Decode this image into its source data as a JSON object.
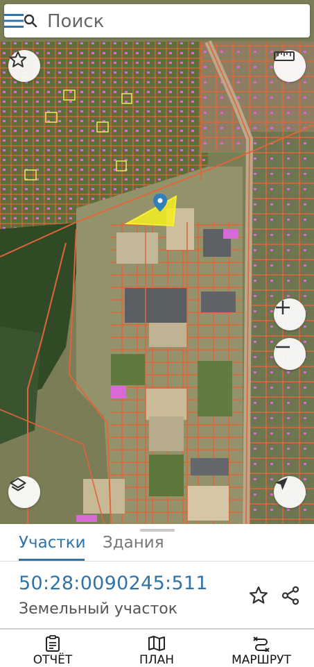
{
  "search": {
    "placeholder": "Поиск"
  },
  "icons": {
    "search": "search-icon",
    "menu": "menu-icon",
    "favorite": "star-outline-icon",
    "ruler": "ruler-icon",
    "zoom_in": "plus-icon",
    "zoom_out": "minus-icon",
    "layers": "layers-icon",
    "location": "navigation-arrow-icon",
    "parcel_marker": "map-pin-icon",
    "report": "clipboard-icon",
    "plan": "map-icon",
    "route": "route-icon",
    "share": "share-icon"
  },
  "colors": {
    "accent": "#2f74a8",
    "parcel_border": "#e0663a",
    "selected_parcel": "#f4ee1f",
    "building": "#d86ad8"
  },
  "sheet": {
    "tabs": [
      "Участки",
      "Здания"
    ],
    "active_tab": "Участки",
    "cadastral_number": "50:28:0090245:511",
    "land_type": "Земельный участок"
  },
  "bottom_nav": {
    "report": "ОТЧЁТ",
    "plan": "ПЛАН",
    "route": "МАРШРУТ"
  }
}
